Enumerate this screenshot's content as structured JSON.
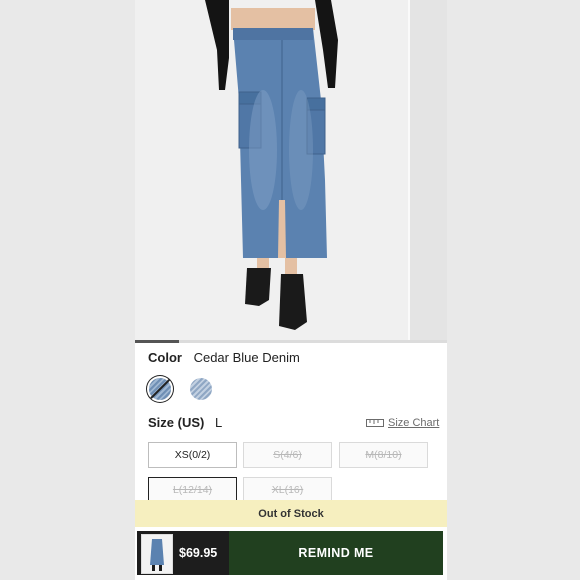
{
  "product": {
    "color_label": "Color",
    "color_value": "Cedar Blue Denim",
    "swatches": [
      {
        "name": "Cedar Blue Denim",
        "selected": true,
        "available": false
      },
      {
        "name": "Light Blue Denim",
        "selected": false,
        "available": true
      }
    ],
    "size_label": "Size (US)",
    "size_value": "L",
    "size_chart_label": "Size Chart",
    "sizes": [
      {
        "label": "XS(0/2)",
        "available": true,
        "selected": false
      },
      {
        "label": "S(4/6)",
        "available": false,
        "selected": false
      },
      {
        "label": "M(8/10)",
        "available": false,
        "selected": false
      },
      {
        "label": "L(12/14)",
        "available": false,
        "selected": true
      },
      {
        "label": "XL(16)",
        "available": false,
        "selected": false
      }
    ],
    "stock_banner": "Out of Stock",
    "price": "$69.95",
    "cta_label": "REMIND ME"
  },
  "colors": {
    "page_bg": "#e9e9e9",
    "banner_bg": "#f6efbf",
    "cta_bg": "#21401f",
    "denim": "#5b82b0"
  },
  "icons": {
    "size_chart": "ruler-icon",
    "unavailable_swatch": "slash-icon"
  }
}
